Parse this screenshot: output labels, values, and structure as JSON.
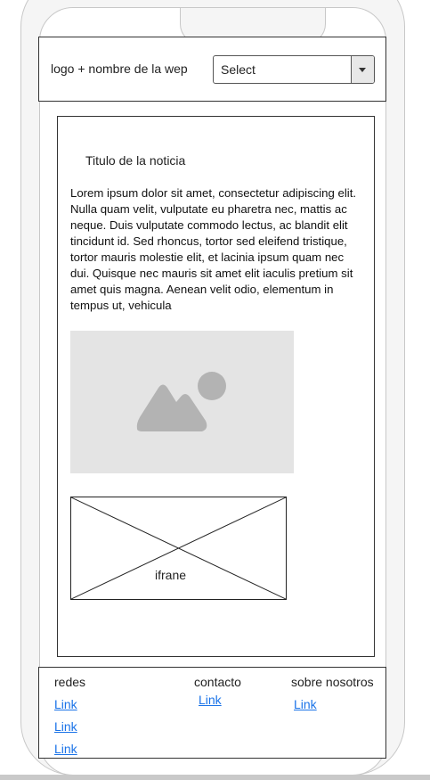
{
  "header": {
    "brand": "logo + nombre de la wep",
    "select_value": "Select"
  },
  "article": {
    "title": "Titulo de la noticia",
    "body": "Lorem ipsum dolor sit amet, consectetur adipiscing elit. Nulla quam velit, vulputate eu pharetra nec, mattis ac neque. Duis vulputate commodo lectus, ac blandit elit tincidunt id. Sed rhoncus, tortor sed eleifend tristique, tortor mauris molestie elit, et lacinia ipsum quam nec dui. Quisque nec mauris sit amet elit iaculis pretium sit amet quis magna. Aenean velit odio, elementum in tempus ut, vehicula",
    "iframe_label": "ifrane"
  },
  "footer": {
    "redes": {
      "heading": "redes",
      "links": [
        "Link",
        "Link",
        "Link"
      ]
    },
    "contacto": {
      "heading": "contacto",
      "links": [
        "Link"
      ]
    },
    "sobre": {
      "heading": "sobre nosotros",
      "links": [
        "Link"
      ]
    }
  },
  "colors": {
    "link": "#1a73e8",
    "placeholder_bg": "#e4e4e4",
    "placeholder_icon": "#b3b3b3"
  }
}
